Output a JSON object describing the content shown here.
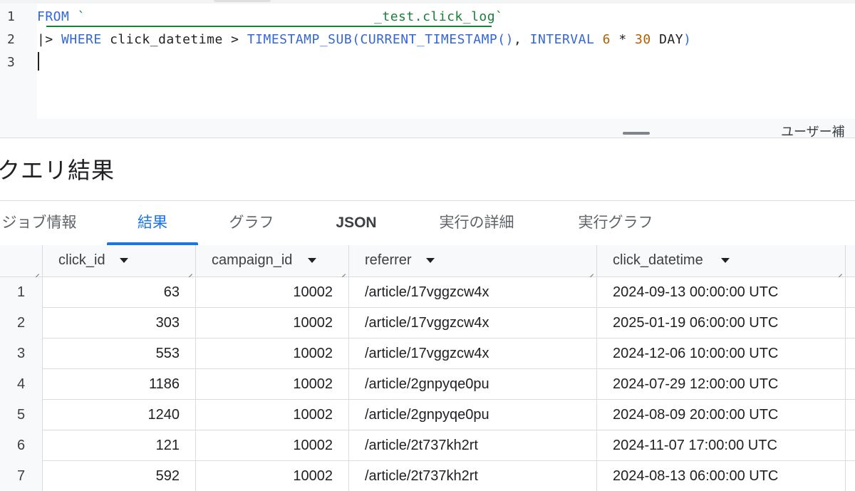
{
  "editor": {
    "line_numbers": [
      "1",
      "2",
      "3"
    ],
    "line1": {
      "kw": "FROM",
      "table_open": "`",
      "table_name": "_test.click_log",
      "table_close": "`"
    },
    "line2": {
      "pipe": "|>",
      "where": "WHERE",
      "column": "click_datetime",
      "op": ">",
      "fn1": "TIMESTAMP_SUB(",
      "fn2": "CURRENT_TIMESTAMP()",
      "comma": ",",
      "interval": "INTERVAL",
      "n1": "6",
      "mul": "*",
      "n2": "30",
      "unit": "DAY",
      "close": ")"
    },
    "user_assist_label": "ユーザー補"
  },
  "results": {
    "title": "クエリ結果",
    "tabs": [
      "ジョブ情報",
      "結果",
      "グラフ",
      "JSON",
      "実行の詳細",
      "実行グラフ"
    ],
    "active_tab": "結果",
    "columns": [
      "click_id",
      "campaign_id",
      "referrer",
      "click_datetime"
    ],
    "rows": [
      {
        "n": "1",
        "click_id": "63",
        "campaign_id": "10002",
        "referrer": "/article/17vggzcw4x",
        "click_datetime": "2024-09-13 00:00:00 UTC"
      },
      {
        "n": "2",
        "click_id": "303",
        "campaign_id": "10002",
        "referrer": "/article/17vggzcw4x",
        "click_datetime": "2025-01-19 06:00:00 UTC"
      },
      {
        "n": "3",
        "click_id": "553",
        "campaign_id": "10002",
        "referrer": "/article/17vggzcw4x",
        "click_datetime": "2024-12-06 10:00:00 UTC"
      },
      {
        "n": "4",
        "click_id": "1186",
        "campaign_id": "10002",
        "referrer": "/article/2gnpyqe0pu",
        "click_datetime": "2024-07-29 12:00:00 UTC"
      },
      {
        "n": "5",
        "click_id": "1240",
        "campaign_id": "10002",
        "referrer": "/article/2gnpyqe0pu",
        "click_datetime": "2024-08-09 20:00:00 UTC"
      },
      {
        "n": "6",
        "click_id": "121",
        "campaign_id": "10002",
        "referrer": "/article/2t737kh2rt",
        "click_datetime": "2024-11-07 17:00:00 UTC"
      },
      {
        "n": "7",
        "click_id": "592",
        "campaign_id": "10002",
        "referrer": "/article/2t737kh2rt",
        "click_datetime": "2024-08-13 06:00:00 UTC"
      }
    ]
  },
  "colors": {
    "keyword": "#3367d6",
    "table_ref": "#188038",
    "number": "#b06000",
    "active_tab": "#1a73e8"
  },
  "icons": [
    "sort-arrow-icon",
    "column-resize-icon",
    "drag-handle-icon"
  ]
}
